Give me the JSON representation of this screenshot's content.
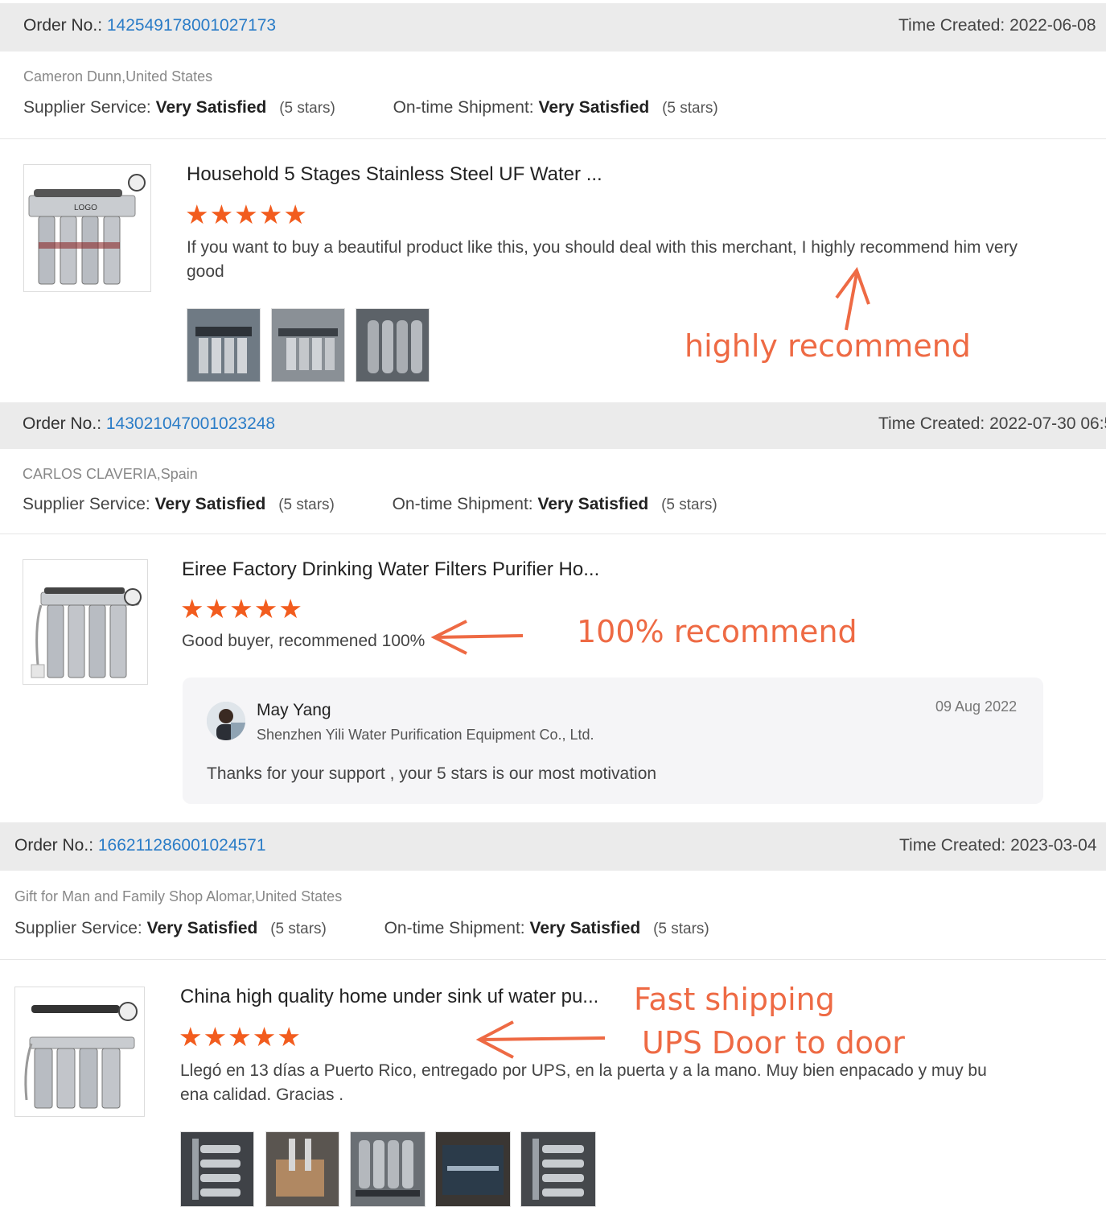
{
  "labels": {
    "order_no": "Order No.:",
    "time_created": "Time Created:",
    "supplier_service": "Supplier Service:",
    "ontime_shipment": "On-time Shipment:",
    "stars": "★★★★★"
  },
  "orders": [
    {
      "order_number": "142549178001027173",
      "time_created": "2022-06-08",
      "buyer": "Cameron Dunn,United States",
      "supplier_rating": "Very Satisfied",
      "supplier_stars": "(5 stars)",
      "shipment_rating": "Very Satisfied",
      "shipment_stars": "(5 stars)",
      "product_title": "Household 5 Stages Stainless Steel UF Water ...",
      "product_image_label": "LOGO",
      "star_rating": 5,
      "review_text": "If you want to buy a beautiful product like this, you should deal with this merchant, I highly recommend him very good",
      "annotation": "highly recommend"
    },
    {
      "order_number": "143021047001023248",
      "time_created": "2022-07-30 06:5",
      "buyer": "CARLOS CLAVERIA,Spain",
      "supplier_rating": "Very Satisfied",
      "supplier_stars": "(5 stars)",
      "shipment_rating": "Very Satisfied",
      "shipment_stars": "(5 stars)",
      "product_title": "Eiree Factory Drinking Water Filters Purifier Ho...",
      "star_rating": 5,
      "review_text": "Good buyer, recommened 100%",
      "annotation": "100% recommend",
      "reply": {
        "name": "May Yang",
        "company": "Shenzhen Yili Water Purification Equipment Co., Ltd.",
        "date": "09 Aug 2022",
        "text": "Thanks for your support , your 5  stars is our most motivation"
      }
    },
    {
      "order_number": "166211286001024571",
      "time_created": "2023-03-04",
      "buyer": "Gift for Man and Family Shop Alomar,United States",
      "supplier_rating": "Very Satisfied",
      "supplier_stars": "(5 stars)",
      "shipment_rating": "Very Satisfied",
      "shipment_stars": "(5 stars)",
      "product_title": "China high quality home under sink uf water pu...",
      "star_rating": 5,
      "review_text": "Llegó en  13 días a Puerto Rico, entregado por UPS, en la puerta y a la mano. Muy bien enpacado y muy bu ena calidad. Gracias .",
      "annotation_line1": "Fast shipping",
      "annotation_line2": "UPS Door to door"
    }
  ],
  "colors": {
    "accent_link": "#2a7cc7",
    "star": "#f25c1e",
    "annotation": "#ee6a44",
    "header_bg": "#ebebeb"
  },
  "icons": [
    "star-icon",
    "arrow-annotation-icon",
    "avatar"
  ]
}
